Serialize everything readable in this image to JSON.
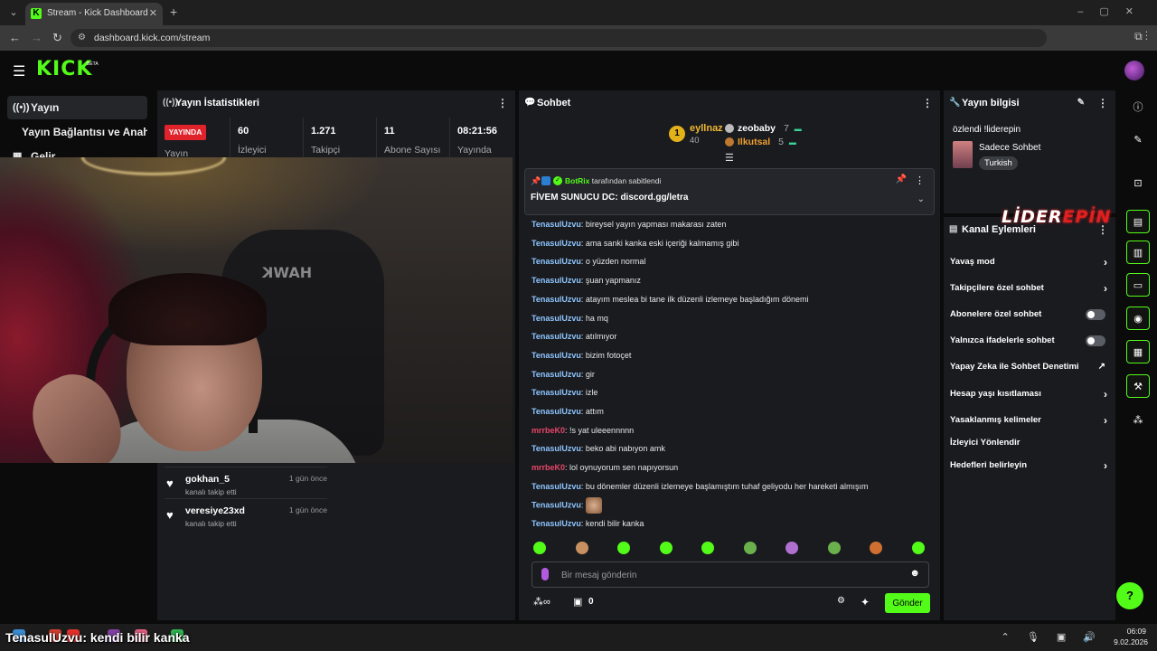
{
  "browser": {
    "tab_title": "Stream - Kick Dashboard",
    "url": "dashboard.kick.com/stream",
    "favicon": "K"
  },
  "header": {
    "logo": "KICK",
    "beta": "BETA"
  },
  "nav": {
    "items": [
      {
        "label": "Yayın",
        "icon": "live-icon"
      },
      {
        "label": "Yayın Bağlantısı ve Anahtarı",
        "icon": ""
      },
      {
        "label": "Gelir",
        "icon": "grid-icon"
      }
    ]
  },
  "stats": {
    "title": "Yayın İstatistikleri",
    "live_badge": "YAYINDA",
    "live_label": "Yayın",
    "items": [
      {
        "value": "60",
        "label": "İzleyici"
      },
      {
        "value": "1.271",
        "label": "Takipçi"
      },
      {
        "value": "11",
        "label": "Abone Sayısı"
      },
      {
        "value": "08:21:56",
        "label": "Yayında"
      }
    ]
  },
  "events": [
    {
      "name": "gokhan_5",
      "time": "1 gün önce",
      "action": "kanalı takip etti"
    },
    {
      "name": "veresiye23xd",
      "time": "1 gün önce",
      "action": "kanalı takip etti"
    }
  ],
  "chat": {
    "title": "Sohbet",
    "leaderboard": {
      "first": {
        "rank": "1",
        "name": "eyllnaz",
        "score": "40"
      },
      "others": [
        {
          "name": "zeobaby",
          "num": "7",
          "color": "#ffffff"
        },
        {
          "name": "Ilkutsal",
          "num": "5",
          "color": "#f0a030"
        }
      ]
    },
    "pinned": {
      "by_user": "BotRix",
      "by_suffix": "tarafından sabitlendi",
      "text": "FİVEM SUNUCU DC: discord.gg/letra"
    },
    "messages": [
      {
        "user": "TenasulUzvu",
        "color": "#8fc6ff",
        "text": "bireysel yayın yapması makarası zaten"
      },
      {
        "user": "TenasulUzvu",
        "color": "#8fc6ff",
        "text": "ama sanki kanka eski içeriği kalmamış gibi"
      },
      {
        "user": "TenasulUzvu",
        "color": "#8fc6ff",
        "text": "o yüzden normal"
      },
      {
        "user": "TenasulUzvu",
        "color": "#8fc6ff",
        "text": "şuan yapmanız"
      },
      {
        "user": "TenasulUzvu",
        "color": "#8fc6ff",
        "text": "atayım meslea bi tane ilk düzenli izlemeye başladığım dönemi"
      },
      {
        "user": "TenasulUzvu",
        "color": "#8fc6ff",
        "text": "ha mq"
      },
      {
        "user": "TenasulUzvu",
        "color": "#8fc6ff",
        "text": "atılmıyor"
      },
      {
        "user": "TenasulUzvu",
        "color": "#8fc6ff",
        "text": "bizim fotoçet"
      },
      {
        "user": "TenasulUzvu",
        "color": "#8fc6ff",
        "text": "gir"
      },
      {
        "user": "TenasulUzvu",
        "color": "#8fc6ff",
        "text": "izle"
      },
      {
        "user": "TenasulUzvu",
        "color": "#8fc6ff",
        "text": "attım"
      },
      {
        "user": "mrrbeK0",
        "color": "#e8466a",
        "text": "!s yat uleeennnnn"
      },
      {
        "user": "TenasulUzvu",
        "color": "#8fc6ff",
        "text": "beko abi nabıyon amk"
      },
      {
        "user": "mrrbeK0",
        "color": "#e8466a",
        "text": "lol oynuyorum sen napıyorsun"
      },
      {
        "user": "TenasulUzvu",
        "color": "#8fc6ff",
        "text": "bu dönemler düzenli izlemeye başlamıştım tuhaf geliyodu her hareketi almışım"
      },
      {
        "user": "TenasulUzvu",
        "color": "#8fc6ff",
        "text": ""
      },
      {
        "user": "TenasulUzvu",
        "color": "#8fc6ff",
        "text": "kendi bilir kanka"
      }
    ],
    "input_placeholder": "Bir mesaj gönderin",
    "footer_count": "0",
    "send_label": "Gönder"
  },
  "info": {
    "title": "Yayın bilgisi",
    "stream_title": "özlendi !liderepin",
    "category": "Sadece Sohbet",
    "tag": "Turkish"
  },
  "actions": {
    "title": "Kanal Eylemleri",
    "items": [
      {
        "label": "Yavaş mod",
        "kind": "chevron"
      },
      {
        "label": "Takipçilere özel sohbet",
        "kind": "chevron"
      },
      {
        "label": "Abonelere özel sohbet",
        "kind": "toggle"
      },
      {
        "label": "Yalnızca ifadelerle sohbet",
        "kind": "toggle"
      },
      {
        "label": "Yapay Zeka ile Sohbet Denetimi",
        "kind": "external"
      },
      {
        "label": "Hesap yaşı kısıtlaması",
        "kind": "chevron"
      },
      {
        "label": "Yasaklanmış kelimeler",
        "kind": "chevron"
      },
      {
        "label": "İzleyici Yönlendir",
        "kind": "none"
      },
      {
        "label": "Hedefleri belirleyin",
        "kind": "chevron"
      }
    ]
  },
  "overlay": {
    "brand_a": "LİDER",
    "brand_b": "EPİN",
    "caption_user": "TenasulUzvu",
    "caption_text": ": kendi bilir kanka",
    "chair_logo": "HAWK"
  },
  "taskbar": {
    "time": "06:09",
    "date": "9.02.2026"
  },
  "colors": {
    "accent": "#53fc18",
    "live": "#e0222b",
    "panel": "#191b1f"
  }
}
